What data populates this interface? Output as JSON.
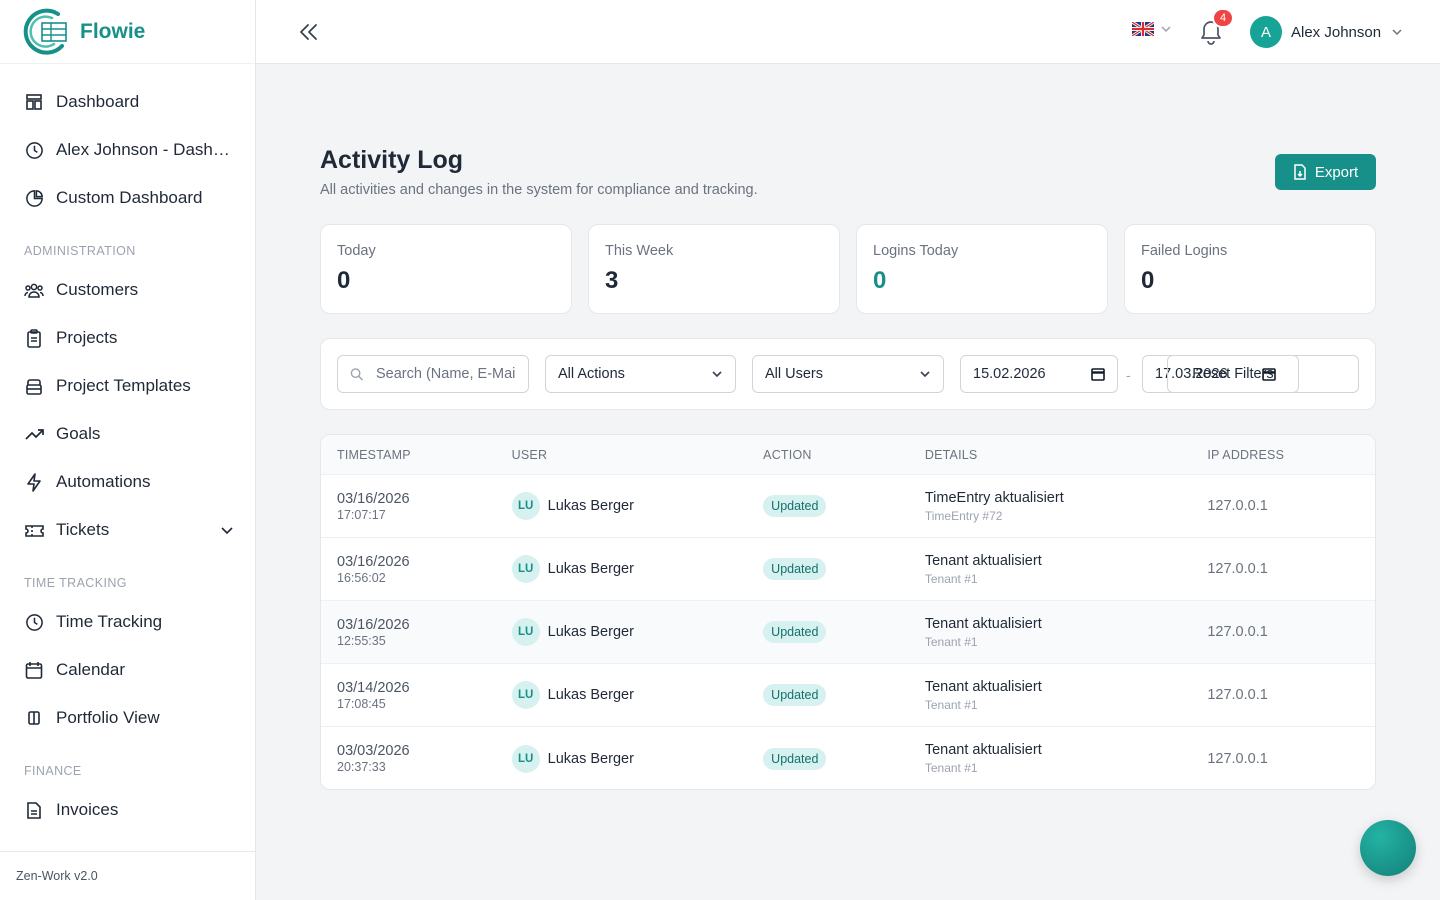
{
  "brand": {
    "name": "Flowie"
  },
  "sidebar": {
    "items_top": [
      {
        "label": "Dashboard",
        "icon": "dashboard-icon"
      },
      {
        "label": "Alex Johnson - Dashboard",
        "icon": "clock-icon"
      },
      {
        "label": "Custom Dashboard",
        "icon": "pie-chart-icon"
      }
    ],
    "sections": {
      "administration": "ADMINISTRATION",
      "time_tracking": "TIME TRACKING",
      "finance": "FINANCE"
    },
    "items_admin": [
      {
        "label": "Customers",
        "icon": "users-icon"
      },
      {
        "label": "Projects",
        "icon": "clipboard-icon"
      },
      {
        "label": "Project Templates",
        "icon": "template-icon"
      },
      {
        "label": "Goals",
        "icon": "trending-up-icon"
      },
      {
        "label": "Automations",
        "icon": "lightning-icon"
      },
      {
        "label": "Tickets",
        "icon": "ticket-icon"
      }
    ],
    "items_time": [
      {
        "label": "Time Tracking",
        "icon": "clock-icon"
      },
      {
        "label": "Calendar",
        "icon": "calendar-icon"
      },
      {
        "label": "Portfolio View",
        "icon": "columns-icon"
      }
    ],
    "items_finance": [
      {
        "label": "Invoices",
        "icon": "document-icon"
      }
    ],
    "footer": "Zen-Work v2.0"
  },
  "header": {
    "notifications_count": "4",
    "user_initial": "A",
    "user_name": "Alex Johnson"
  },
  "page": {
    "title": "Activity Log",
    "subtitle": "All activities and changes in the system for compliance and tracking.",
    "export_label": "Export"
  },
  "stats": [
    {
      "label": "Today",
      "value": "0"
    },
    {
      "label": "This Week",
      "value": "3"
    },
    {
      "label": "Logins Today",
      "value": "0"
    },
    {
      "label": "Failed Logins",
      "value": "0"
    }
  ],
  "filters": {
    "search_placeholder": "Search (Name, E-Mail...)",
    "actions_value": "All Actions",
    "users_value": "All Users",
    "date_from": "15.02.2026",
    "date_to": "17.03.2026",
    "reset_label": "Reset Filters"
  },
  "table": {
    "columns": [
      "TIMESTAMP",
      "USER",
      "ACTION",
      "DETAILS",
      "IP ADDRESS"
    ],
    "rows": [
      {
        "date": "03/16/2026",
        "time": "17:07:17",
        "initials": "LU",
        "user": "Lukas Berger",
        "action": "Updated",
        "detail": "TimeEntry aktualisiert",
        "detail_sub": "TimeEntry #72",
        "ip": "127.0.0.1"
      },
      {
        "date": "03/16/2026",
        "time": "16:56:02",
        "initials": "LU",
        "user": "Lukas Berger",
        "action": "Updated",
        "detail": "Tenant aktualisiert",
        "detail_sub": "Tenant #1",
        "ip": "127.0.0.1"
      },
      {
        "date": "03/16/2026",
        "time": "12:55:35",
        "initials": "LU",
        "user": "Lukas Berger",
        "action": "Updated",
        "detail": "Tenant aktualisiert",
        "detail_sub": "Tenant #1",
        "ip": "127.0.0.1"
      },
      {
        "date": "03/14/2026",
        "time": "17:08:45",
        "initials": "LU",
        "user": "Lukas Berger",
        "action": "Updated",
        "detail": "Tenant aktualisiert",
        "detail_sub": "Tenant #1",
        "ip": "127.0.0.1"
      },
      {
        "date": "03/03/2026",
        "time": "20:37:33",
        "initials": "LU",
        "user": "Lukas Berger",
        "action": "Updated",
        "detail": "Tenant aktualisiert",
        "detail_sub": "Tenant #1",
        "ip": "127.0.0.1"
      }
    ]
  },
  "colors": {
    "accent": "#17908a",
    "badge_bg": "#d6f1ef",
    "notification": "#ef4444"
  }
}
